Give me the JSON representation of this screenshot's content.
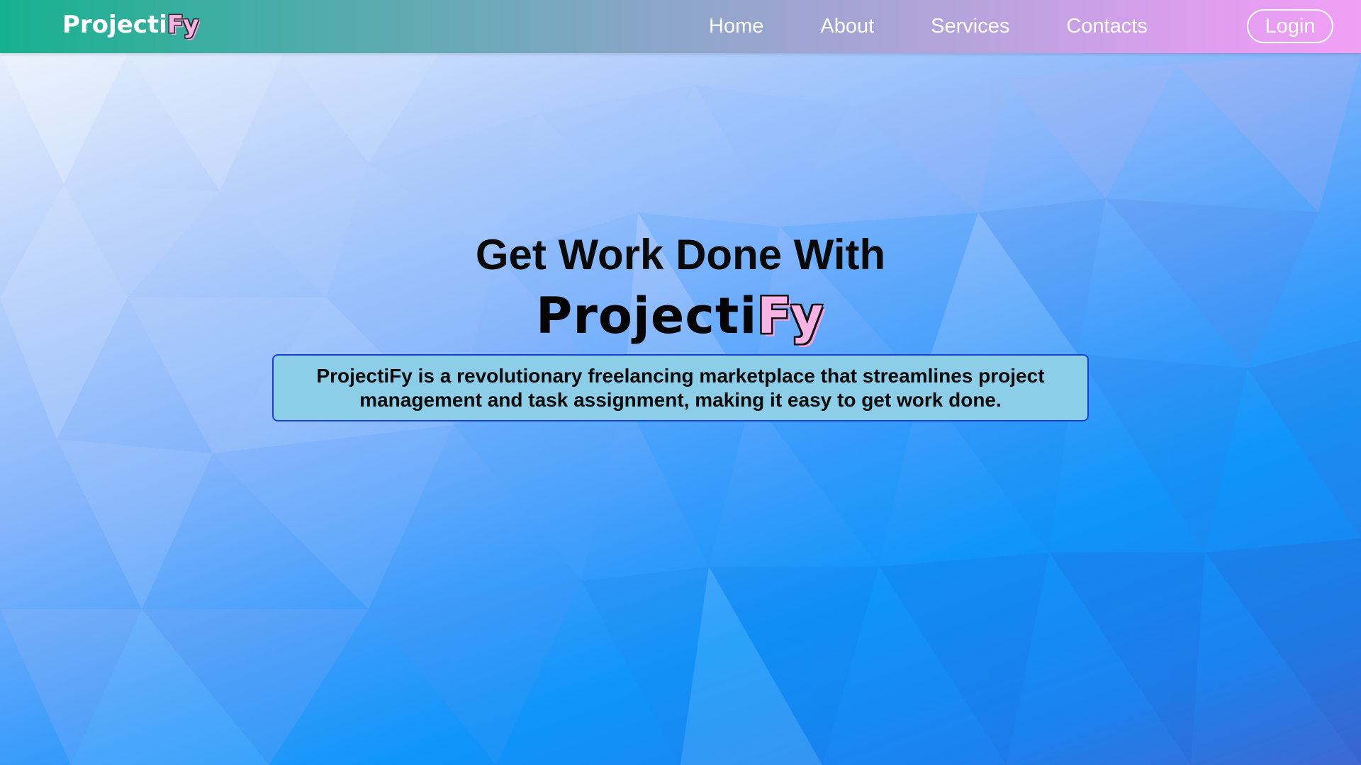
{
  "navbar": {
    "brand_main": "Projecti",
    "brand_accent": "Fy",
    "links": [
      "Home",
      "About",
      "Services",
      "Contacts"
    ],
    "login_label": "Login"
  },
  "hero": {
    "heading": "Get Work Done With",
    "brand_main": "Projecti",
    "brand_accent": "Fy",
    "description": "ProjectiFy is a revolutionary freelancing marketplace that streamlines project management and task assignment, making it easy to get work done."
  },
  "colors": {
    "navbar_start": "#17b18f",
    "navbar_end": "#f0a0f5",
    "brand_accent": "#f6b3e4",
    "desc_box_bg": "#8ccde8",
    "desc_box_border": "#1a3fd8"
  }
}
